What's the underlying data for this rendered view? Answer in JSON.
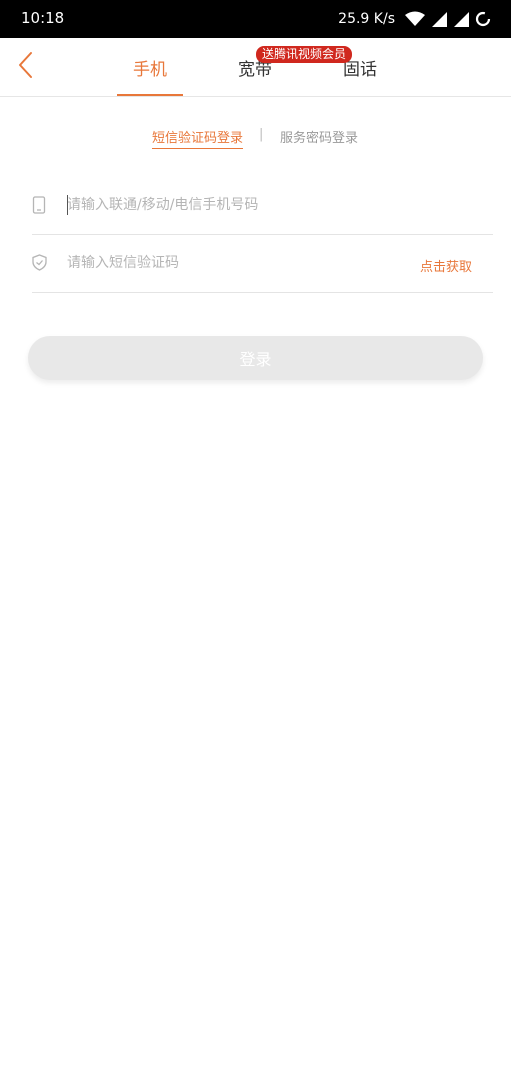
{
  "status_bar": {
    "time": "10:18",
    "speed": "25.9 K/s"
  },
  "tabs": [
    {
      "label": "手机",
      "active": true
    },
    {
      "label": "宽带",
      "active": false
    },
    {
      "label": "固话",
      "active": false
    }
  ],
  "promo_badge": "送腾讯视频会员",
  "login_modes": {
    "sms": "短信验证码登录",
    "divider": "|",
    "password": "服务密码登录"
  },
  "form": {
    "phone_placeholder": "请输入联通/移动/电信手机号码",
    "code_placeholder": "请输入短信验证码",
    "get_code_label": "点击获取",
    "login_label": "登录"
  },
  "colors": {
    "accent": "#e8773a",
    "badge": "#d0281e",
    "button_disabled": "#e8e8e8"
  }
}
